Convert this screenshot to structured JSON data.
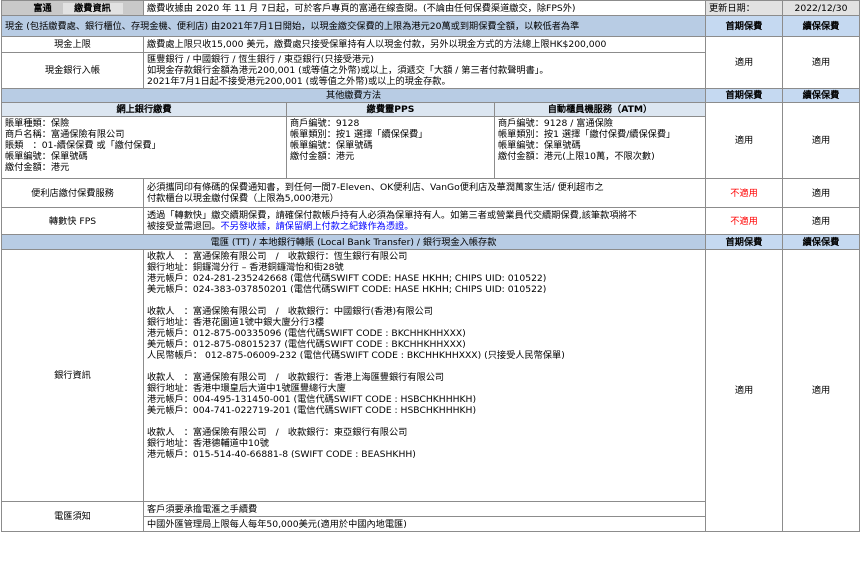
{
  "header": {
    "company": "富通",
    "section": "繳費資訊",
    "notice": "繳費收據由 2020 年 11 月 7日起，可於客戶專頁的富通在線查閱。(不論由任何保費渠道繳交，除FPS外)",
    "update_label": "更新日期：",
    "update_date": "2022/12/30"
  },
  "cash": {
    "band_text": "現金 (包括繳費處、銀行櫃位、存現金機、便利店) 由2021年7月1日開始，以現金繳交保費的上限為港元20萬或到期保費全額，以較低者為準",
    "col_first": "首期保費",
    "col_renew": "續保保費",
    "limit_label": "現金上限",
    "limit_text": "繳費處上限只收15,000 美元，繳費處只接受保單持有人以現金付款，另外以現金方式的方法總上限HK$200,000",
    "bank_label": "現金銀行入帳",
    "bank_lines": [
      "匯豐銀行 / 中國銀行 / 恆生銀行 / 東亞銀行(只接受港元)",
      "如現金存款銀行金額為港元200,001 (或等值之外幣)或以上，須遞交「大額 / 第三者付款聲明書」。",
      "2021年7月1日起不接受港元200,001 (或等值之外幣)或以上的現金存款。"
    ],
    "bank_first": "適用",
    "bank_renew": "適用"
  },
  "other": {
    "band_text": "其他繳費方法",
    "col_first": "首期保費",
    "col_renew": "續保保費",
    "online_title": "網上銀行繳費",
    "pps_title": "繳費靈PPS",
    "atm_title": "自動櫃員機服務（ATM）",
    "online_lines": [
      "賬單種類：保險",
      "商戶名稱：富通保險有限公司",
      "賬類　：01-續保保費 或「繳付保費」",
      "帳單編號：保單號碼",
      "繳付金額：港元"
    ],
    "pps_lines": [
      "商戶編號：9128",
      "帳單類別：按1 選擇「續保保費」",
      "帳單編號：保單號碼",
      "繳付金額：港元"
    ],
    "atm_lines": [
      "商戶編號：9128 / 富通保險",
      "帳單類別：按1 選擇「繳付保費/續保保費」",
      "帳單編號：保單號碼",
      "繳付金額：港元(上限10萬，不限次數)"
    ],
    "methods_first": "適用",
    "methods_renew": "適用",
    "store_label": "便利店繳付保費服務",
    "store_lines": [
      "必須攜同印有條碼的保費通知書，到任何一間7-Eleven、OK便利店、VanGo便利店及華潤萬家生活/ 便利超市之",
      "付款櫃台以現金繳付保費（上限為5,000港元）"
    ],
    "store_first": "不適用",
    "store_renew": "適用",
    "fps_label": "轉數快 FPS",
    "fps_line1": "透過「轉數快」繳交續期保費，請確保付款帳戶持有人必須為保單持有人。如第三者或營業員代交續期保費,該筆款項將不",
    "fps_line2_pre": "被接受並需退回。",
    "fps_line2_blue": "不另發收據，請保留網上付款之紀錄作為憑證。",
    "fps_first": "不適用",
    "fps_renew": "適用"
  },
  "transfer": {
    "band_text": "電匯 (TT) / 本地銀行轉賬 (Local Bank Transfer) / 銀行現金入帳存款",
    "col_first": "首期保費",
    "col_renew": "續保保費",
    "bank_label": "銀行資訊",
    "blocks": [
      [
        "收款人　：富通保險有限公司　/　收款銀行：恆生銀行有限公司",
        "銀行地址：銅鑼灣分行 – 香港銅鑼灣怡和街28號",
        "港元帳戶：024-281-235242668 (電信代碼SWIFT CODE: HASE HKHH; CHIPS UID: 010522)",
        "美元帳戶：024-383-037850201 (電信代碼SWIFT CODE: HASE HKHH; CHIPS UID: 010522)"
      ],
      [
        "收款人　：富通保險有限公司　/　收款銀行：中國銀行(香港)有限公司",
        "銀行地址：香港花園道1號中銀大廈分行3樓",
        "港元帳戶：012-875-00335096 (電信代碼SWIFT CODE : BKCHHKHHXXX)",
        "美元帳戶：012-875-08015237 (電信代碼SWIFT CODE : BKCHHKHHXXX)",
        "人民幣帳戶： 012-875-06009-232 (電信代碼SWIFT CODE : BKCHHKHHXXX) (只接受人民幣保單)"
      ],
      [
        "收款人　：富通保險有限公司　/　收款銀行：香港上海匯豐銀行有限公司",
        "銀行地址：香港中環皇后大道中1號匯豐總行大廈",
        "港元帳戶：004-495-131450-001 (電信代碼SWIFT CODE : HSBCHKHHHKH)",
        "美元帳戶：004-741-022719-201 (電信代碼SWIFT CODE : HSBCHKHHHKH)"
      ],
      [
        "收款人　：富通保險有限公司　/　收款銀行：東亞銀行有限公司",
        "銀行地址：香港德輔道中10號",
        "港元帳戶：015-514-40-66881-8 (SWIFT CODE : BEASHKHH)"
      ]
    ],
    "bank_first": "適用",
    "bank_renew": "適用",
    "notes_label": "電匯須知",
    "note1": "客戶須要承擔電滙之手續費",
    "note2": "中國外匯管理局上限每人每年50,000美元(適用於中國內地電匯)"
  }
}
